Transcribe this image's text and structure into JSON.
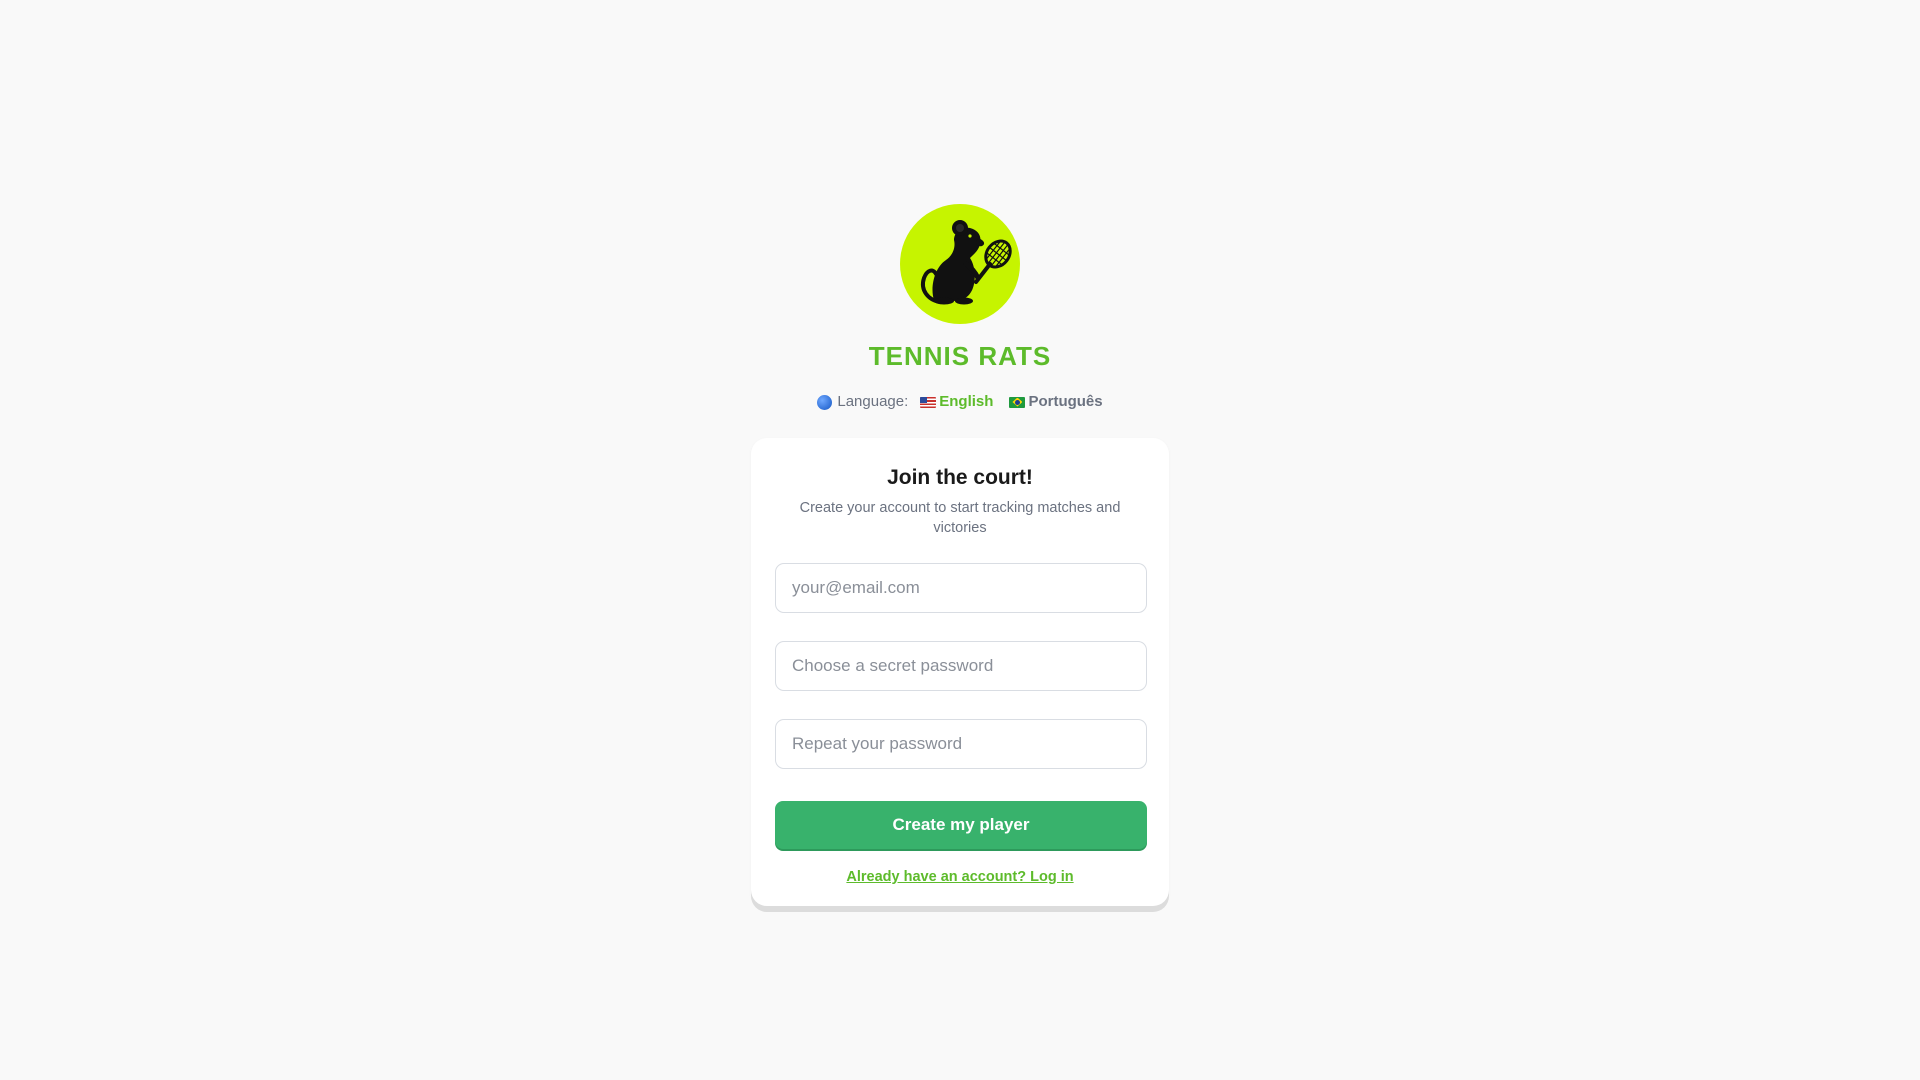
{
  "brand": {
    "name": "TENNIS RATS",
    "logo_icon": "rat-tennis-racket-icon",
    "logo_bg": "#c6f400",
    "accent_color": "#5dbb2b"
  },
  "language": {
    "label": "Language:",
    "icon": "globe-icon",
    "options": [
      {
        "label": "English",
        "flag": "us-flag-icon",
        "selected": true
      },
      {
        "label": "Português",
        "flag": "br-flag-icon",
        "selected": false
      }
    ]
  },
  "signup": {
    "title": "Join the court!",
    "subtitle": "Create your account to start tracking matches and victories",
    "email_placeholder": "your@email.com",
    "password_placeholder": "Choose a secret password",
    "repeat_placeholder": "Repeat your password",
    "submit_label": "Create my player",
    "submit_color": "#38b26c",
    "login_link": "Already have an account? Log in"
  }
}
